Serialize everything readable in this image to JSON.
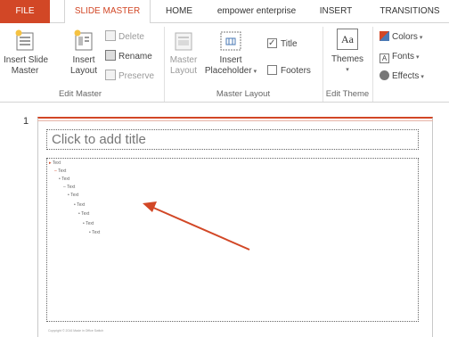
{
  "tabs": [
    {
      "label": "FILE"
    },
    {
      "label": "SLIDE MASTER"
    },
    {
      "label": "HOME"
    },
    {
      "label": "empower enterprise"
    },
    {
      "label": "INSERT"
    },
    {
      "label": "TRANSITIONS"
    }
  ],
  "ribbon": {
    "edit_master": {
      "group_label": "Edit Master",
      "insert_slide_master": "Insert Slide\nMaster",
      "insert_layout": "Insert\nLayout",
      "delete": "Delete",
      "rename": "Rename",
      "preserve": "Preserve"
    },
    "master_layout": {
      "group_label": "Master Layout",
      "master_layout_btn": "Master\nLayout",
      "insert_placeholder": "Insert\nPlaceholder",
      "title_checkbox": "Title",
      "title_checked": true,
      "footers_checkbox": "Footers",
      "footers_checked": false
    },
    "edit_theme": {
      "group_label": "Edit Theme",
      "themes": "Themes",
      "colors": "Colors",
      "fonts": "Fonts",
      "effects": "Effects"
    }
  },
  "slide": {
    "number": "1",
    "title_placeholder": "Click to add title",
    "levels": [
      "Text",
      "Text",
      "Text",
      "Text",
      "Text",
      "Text",
      "Text",
      "Text",
      "Text"
    ],
    "footer": "Copyright © 2016 Made in Office Switch",
    "accent_color": "#d24726"
  }
}
